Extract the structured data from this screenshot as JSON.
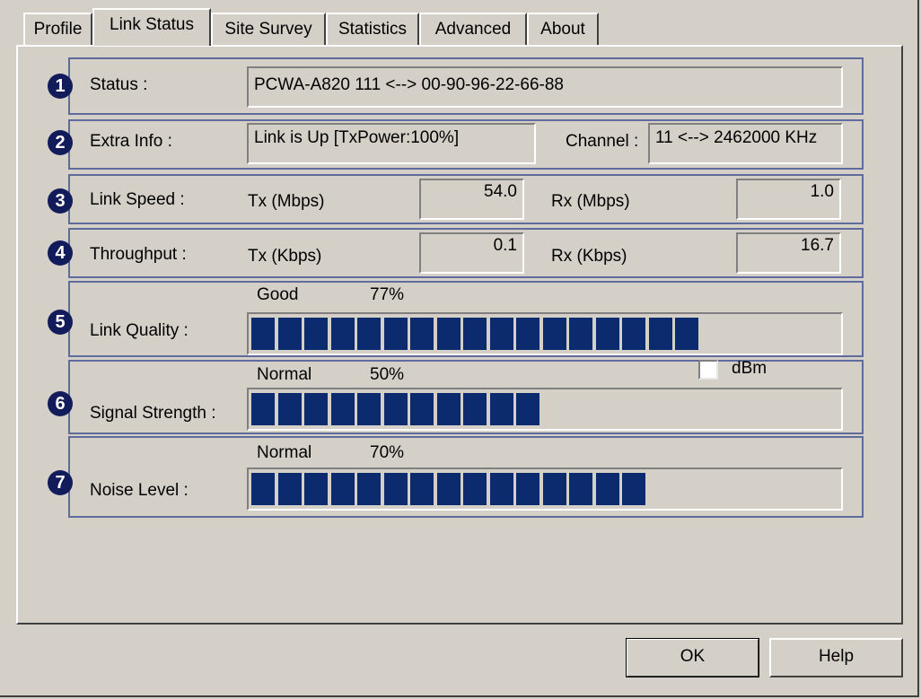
{
  "tabs": [
    "Profile",
    "Link Status",
    "Site Survey",
    "Statistics",
    "Advanced",
    "About"
  ],
  "status": {
    "number": "1",
    "label": "Status :",
    "value": "PCWA-A820 111 <--> 00-90-96-22-66-88"
  },
  "extra_info": {
    "number": "2",
    "label": "Extra Info :",
    "value": "Link is Up [TxPower:100%]",
    "channel_label": "Channel :",
    "channel_value": "11 <--> 2462000 KHz"
  },
  "link_speed": {
    "number": "3",
    "label": "Link Speed :",
    "tx_label": "Tx (Mbps)",
    "tx_value": "54.0",
    "rx_label": "Rx (Mbps)",
    "rx_value": "1.0"
  },
  "throughput": {
    "number": "4",
    "label": "Throughput :",
    "tx_label": "Tx (Kbps)",
    "tx_value": "0.1",
    "rx_label": "Rx (Kbps)",
    "rx_value": "16.7"
  },
  "link_quality": {
    "number": "5",
    "label": "Link Quality :",
    "status": "Good",
    "percent_text": "77%",
    "level": 0.77
  },
  "signal_strength": {
    "number": "6",
    "label": "Signal Strength :",
    "status": "Normal",
    "percent_text": "50%",
    "level": 0.5,
    "dbm_label": "dBm",
    "dbm_checked": false
  },
  "noise_level": {
    "number": "7",
    "label": "Noise Level :",
    "status": "Normal",
    "percent_text": "70%",
    "level": 0.7
  },
  "buttons": {
    "ok": "OK",
    "help": "Help"
  },
  "colors": {
    "bar_fill": "#0c2a6e",
    "badge": "#131c5a",
    "group_border": "#5f6b9a"
  }
}
